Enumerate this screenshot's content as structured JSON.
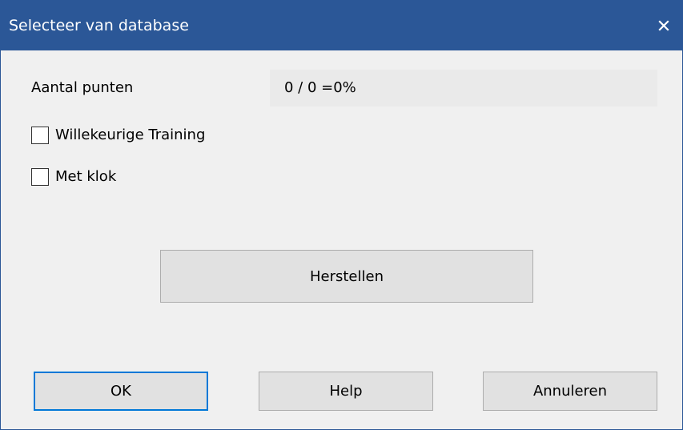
{
  "window": {
    "title": "Selecteer van database",
    "close_icon": "close-icon",
    "titlebar_color": "#2b5797",
    "accent_color": "#0078d7"
  },
  "points": {
    "label": "Aantal punten",
    "value": "0 / 0 =0%"
  },
  "options": {
    "random_training": {
      "label": "Willekeurige Training",
      "checked": false
    },
    "with_clock": {
      "label": "Met klok",
      "checked": false
    }
  },
  "buttons": {
    "reset": "Herstellen",
    "ok": "OK",
    "help": "Help",
    "cancel": "Annuleren"
  }
}
